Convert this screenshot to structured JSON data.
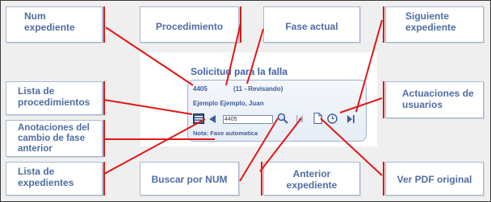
{
  "labels": {
    "num_expediente": "Num\nexpediente",
    "procedimiento": "Procedimiento",
    "fase_actual": "Fase actual",
    "siguiente_expediente": "Siguiente\nexpediente",
    "lista_procedimientos": "Lista de\nprocedimientos",
    "actuaciones_usuarios": "Actuaciones de\nusuarios",
    "anotaciones": "Anotaciones del\ncambio de fase\nanterior",
    "lista_expedientes": "Lista de\nexpedientes",
    "buscar_num": "Buscar por NUM",
    "anterior_expediente": "Anterior\nexpediente",
    "ver_pdf": "Ver PDF original"
  },
  "panel": {
    "title": "Solicitud para la falla",
    "record_number": "4405",
    "status": "(11 - Revisando)",
    "person": "Ejemplo Ejemplo, Juan",
    "input_value": "4405",
    "note": "Nota: Fase automatica"
  },
  "icons": [
    "list-icon",
    "back-arrow-icon",
    "search-icon",
    "first-record-icon",
    "pdf-icon",
    "clock-icon",
    "next-record-icon"
  ],
  "colors": {
    "arrow": "#e01818",
    "label_text": "#4f6da3",
    "panel_text": "#3e5c96"
  }
}
